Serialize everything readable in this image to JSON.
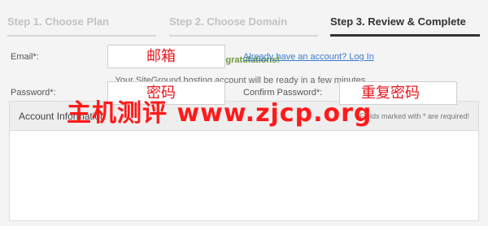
{
  "steps": [
    {
      "label": "Step 1. Choose Plan",
      "state": "inactive"
    },
    {
      "label": "Step 2. Choose Domain",
      "state": "inactive"
    },
    {
      "label": "Step 3. Review & Complete",
      "state": "active"
    }
  ],
  "messages": {
    "congrats": "Congratulations!",
    "subtitle": "Your SiteGround hosting account will be ready in a few minutes..."
  },
  "account_panel": {
    "title": "Account Information",
    "required_note": "Fields marked with * are required!",
    "email_label": "Email*:",
    "email_value": "邮箱",
    "login_link": "Already have an account? Log In",
    "password_label": "Password*:",
    "password_value": "密码",
    "confirm_label": "Confirm Password*:",
    "confirm_value": "重复密码"
  },
  "watermark": "主机测评 www.zjcp.org",
  "colors": {
    "congrats": "#6f9a3b",
    "link": "#3a7bc8",
    "watermark": "#ff1a1a",
    "active_step": "#333333",
    "inactive_step": "#c2c2c2"
  }
}
